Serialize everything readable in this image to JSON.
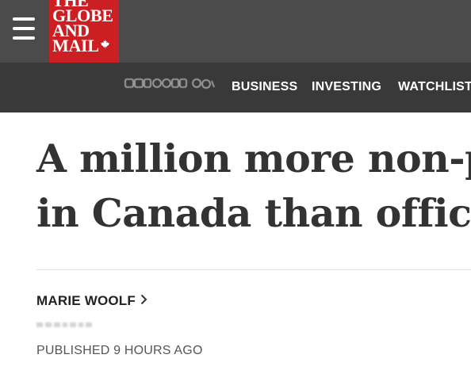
{
  "header": {
    "menu_icon": "hamburger-menu-icon",
    "logo_lines": [
      "THE",
      "GLOBE",
      "AND",
      "MAIL"
    ],
    "logo_icon": "maple-leaf-icon",
    "brand_color": "#cc1f24",
    "topbar_color": "#4b4b4b"
  },
  "nav": {
    "blurred_label": "",
    "items": [
      "BUSINESS",
      "INVESTING",
      "WATCHLIST"
    ],
    "bar_color": "#393939"
  },
  "article": {
    "headline_line1": "A million more non-p",
    "headline_line2": "in Canada than offici",
    "author": "MARIE WOOLF",
    "author_chevron_icon": "chevron-right-icon",
    "author_role_blurred": "",
    "published": "PUBLISHED 9 HOURS AGO"
  }
}
